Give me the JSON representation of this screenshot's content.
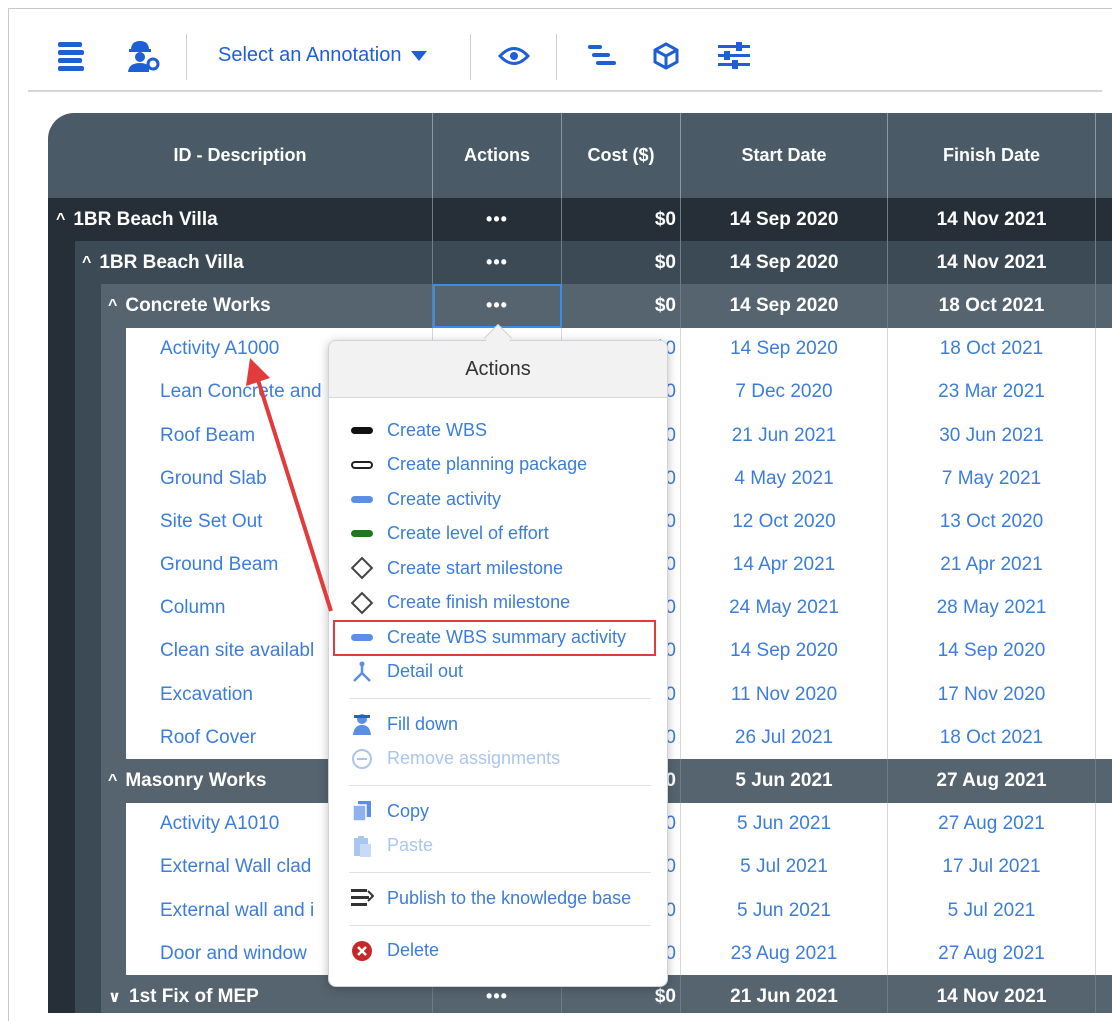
{
  "toolbar": {
    "select_label": "Select an Annotation",
    "icons": [
      "wbs-list-icon",
      "worker-settings-icon",
      "eye-icon",
      "gantt-icon",
      "cube-icon",
      "sliders-icon"
    ]
  },
  "table": {
    "columns": [
      "ID - Description",
      "Actions",
      "Cost ($)",
      "Start Date",
      "Finish Date"
    ],
    "rows": [
      {
        "level": "l0",
        "chev": "^",
        "name": "1BR Beach Villa",
        "actions": "•••",
        "cost": "$0",
        "start": "14 Sep 2020",
        "finish": "14 Nov 2021"
      },
      {
        "level": "l1",
        "chev": "^",
        "name": "1BR Beach Villa",
        "actions": "•••",
        "cost": "$0",
        "start": "14 Sep 2020",
        "finish": "14 Nov 2021"
      },
      {
        "level": "l2",
        "chev": "^",
        "name": "Concrete Works",
        "actions": "•••",
        "cost": "$0",
        "start": "14 Sep 2020",
        "finish": "18 Oct 2021"
      },
      {
        "level": "act",
        "name": "Activity A1000",
        "cost": "$0",
        "start": "14 Sep 2020",
        "finish": "18 Oct 2021"
      },
      {
        "level": "act",
        "name": "Lean Concrete and",
        "cost": "$0",
        "start": "7 Dec 2020",
        "finish": "23 Mar 2021"
      },
      {
        "level": "act",
        "name": "Roof Beam",
        "cost": "$0",
        "start": "21 Jun 2021",
        "finish": "30 Jun 2021"
      },
      {
        "level": "act",
        "name": "Ground Slab",
        "cost": "$0",
        "start": "4 May 2021",
        "finish": "7 May 2021"
      },
      {
        "level": "act",
        "name": "Site Set Out",
        "cost": "$0",
        "start": "12 Oct 2020",
        "finish": "13 Oct 2020"
      },
      {
        "level": "act",
        "name": "Ground Beam",
        "cost": "$0",
        "start": "14 Apr 2021",
        "finish": "21 Apr 2021"
      },
      {
        "level": "act",
        "name": "Column",
        "cost": "$0",
        "start": "24 May 2021",
        "finish": "28 May 2021"
      },
      {
        "level": "act",
        "name": "Clean site availabl",
        "cost": "$0",
        "start": "14 Sep 2020",
        "finish": "14 Sep 2020"
      },
      {
        "level": "act",
        "name": "Excavation",
        "cost": "$0",
        "start": "11 Nov 2020",
        "finish": "17 Nov 2020"
      },
      {
        "level": "act",
        "name": "Roof Cover",
        "cost": "$0",
        "start": "26 Jul 2021",
        "finish": "18 Oct 2021"
      },
      {
        "level": "l2",
        "chev": "^",
        "name": "Masonry Works",
        "actions": "•••",
        "cost": "$0",
        "start": "5 Jun 2021",
        "finish": "27 Aug 2021"
      },
      {
        "level": "act",
        "name": "Activity A1010",
        "cost": "$0",
        "start": "5 Jun 2021",
        "finish": "27 Aug 2021"
      },
      {
        "level": "act",
        "name": "External Wall clad",
        "cost": "$0",
        "start": "5 Jul 2021",
        "finish": "17 Jul 2021"
      },
      {
        "level": "act",
        "name": "External wall and i",
        "cost": "$0",
        "start": "5 Jun 2021",
        "finish": "5 Jul 2021"
      },
      {
        "level": "act",
        "name": "Door and window",
        "cost": "$0",
        "start": "23 Aug 2021",
        "finish": "27 Aug 2021"
      },
      {
        "level": "l2",
        "chev": "v",
        "name": "1st Fix of MEP",
        "actions": "•••",
        "cost": "$0",
        "start": "21 Jun 2021",
        "finish": "14 Nov 2021"
      }
    ]
  },
  "popup": {
    "title": "Actions",
    "items": [
      {
        "label": "Create WBS",
        "icon": "black-bar-icon",
        "color": "#111111"
      },
      {
        "label": "Create planning package",
        "icon": "outline-bar-icon",
        "color": "#ffffff"
      },
      {
        "label": "Create activity",
        "icon": "blue-bar-icon",
        "color": "#5b8ee6"
      },
      {
        "label": "Create level of effort",
        "icon": "green-bar-icon",
        "color": "#1c7a1c"
      },
      {
        "label": "Create start milestone",
        "icon": "diamond-icon"
      },
      {
        "label": "Create finish milestone",
        "icon": "diamond-icon"
      },
      {
        "label": "Create WBS summary activity",
        "icon": "blue-bar-icon",
        "color": "#5b8ee6"
      },
      {
        "label": "Detail out",
        "icon": "branch-icon"
      },
      {
        "separator": true
      },
      {
        "label": "Fill down",
        "icon": "person-icon"
      },
      {
        "label": "Remove assignments",
        "icon": "minus-circle-icon",
        "disabled": true
      },
      {
        "separator": true
      },
      {
        "label": "Copy",
        "icon": "copy-icon"
      },
      {
        "label": "Paste",
        "icon": "paste-icon",
        "disabled": true
      },
      {
        "separator": true
      },
      {
        "label": "Publish to the knowledge base",
        "icon": "publish-icon"
      },
      {
        "separator": true
      },
      {
        "label": "Delete",
        "icon": "delete-circle-icon"
      }
    ]
  },
  "colors": {
    "accent": "#3b7ddd",
    "highlight": "#e23b3b",
    "header": "#4a5a67"
  }
}
